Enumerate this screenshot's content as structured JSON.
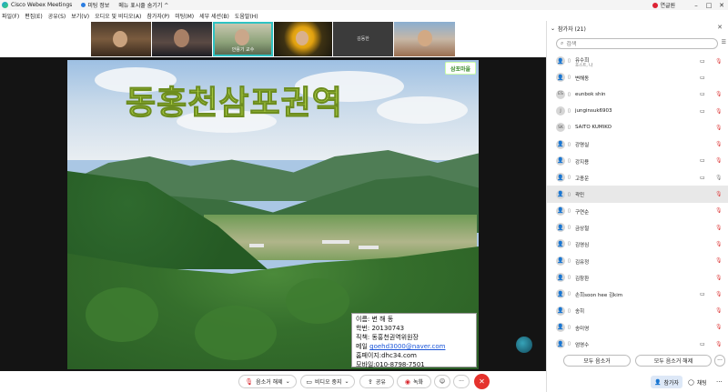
{
  "titlebar": {
    "app_title": "Cisco Webex Meetings",
    "meeting_info": "미팅 정보",
    "hide_menu": "메뉴 표시줄 숨기기 ^",
    "user": "연글원",
    "window_controls": [
      "–",
      "□",
      "✕"
    ]
  },
  "menubar": {
    "items": [
      "파일(F)",
      "편집(E)",
      "공유(S)",
      "보기(V)",
      "오디오 및 비디오(A)",
      "참가자(P)",
      "미팅(M)",
      "세부 세션(B)",
      "도움말(H)"
    ]
  },
  "thumbnails": [
    {
      "name": ""
    },
    {
      "name": ""
    },
    {
      "name": "안용기 교수"
    },
    {
      "name": ""
    },
    {
      "name": "김동한"
    },
    {
      "name": ""
    }
  ],
  "slide": {
    "headline": "동홍천삼포권역",
    "logo_text": "삼포마을",
    "card": {
      "name_line": "이름: 변 해 동",
      "student_id": "학번: 20130743",
      "position": "직책: 동홍천권역위원장",
      "mail_label": "메일",
      "mail": "goehd3000@naver.com",
      "homepage": "홈페이지:dhc34.com",
      "mobile": "모바일:010-8798-7501"
    }
  },
  "toolbar": {
    "mute": "음소거 해제",
    "video": "비디오 중지",
    "share": "공유",
    "record": "녹화",
    "emoji": "☺",
    "more": "···",
    "end": "✕"
  },
  "panel": {
    "title": "참가자 (21)",
    "search_placeholder": "검색",
    "participants": [
      {
        "name": "유수희",
        "sub": "호스트, 나",
        "avatar": "",
        "video": true,
        "mic": "red"
      },
      {
        "name": "변해동",
        "sub": "",
        "avatar": "",
        "video": true,
        "mic": "none"
      },
      {
        "name": "eunbok shin",
        "sub": "",
        "avatar": "ES",
        "video": true,
        "mic": "red"
      },
      {
        "name": "junginsuk6903",
        "sub": "",
        "avatar": "J",
        "video": true,
        "mic": "red"
      },
      {
        "name": "SAITO KUMIKO",
        "sub": "",
        "avatar": "SK",
        "video": false,
        "mic": "red"
      },
      {
        "name": "강명실",
        "sub": "",
        "avatar": "",
        "video": false,
        "mic": "red"
      },
      {
        "name": "강지용",
        "sub": "",
        "avatar": "",
        "video": true,
        "mic": "red"
      },
      {
        "name": "고종운",
        "sub": "",
        "avatar": "",
        "video": true,
        "mic": "gray"
      },
      {
        "name": "곽민",
        "sub": "",
        "avatar": "",
        "video": false,
        "mic": "red"
      },
      {
        "name": "구연순",
        "sub": "",
        "avatar": "",
        "video": false,
        "mic": "red"
      },
      {
        "name": "금상철",
        "sub": "",
        "avatar": "",
        "video": false,
        "mic": "red"
      },
      {
        "name": "김영심",
        "sub": "",
        "avatar": "",
        "video": false,
        "mic": "red"
      },
      {
        "name": "김유정",
        "sub": "",
        "avatar": "",
        "video": false,
        "mic": "red"
      },
      {
        "name": "김창환",
        "sub": "",
        "avatar": "",
        "video": false,
        "mic": "red"
      },
      {
        "name": "손희soon hee 김kim",
        "sub": "",
        "avatar": "",
        "video": true,
        "mic": "red"
      },
      {
        "name": "송히",
        "sub": "",
        "avatar": "",
        "video": false,
        "mic": "red"
      },
      {
        "name": "송미영",
        "sub": "",
        "avatar": "",
        "video": false,
        "mic": "red"
      },
      {
        "name": "엄영수",
        "sub": "",
        "avatar": "",
        "video": true,
        "mic": "red"
      }
    ],
    "selected_participant": "곽민",
    "mute_all": "모두 음소거",
    "unmute_all": "모두 음소거 해제",
    "more": "···",
    "footer_participants": "참가자",
    "footer_chat": "채팅",
    "footer_more": "···"
  }
}
